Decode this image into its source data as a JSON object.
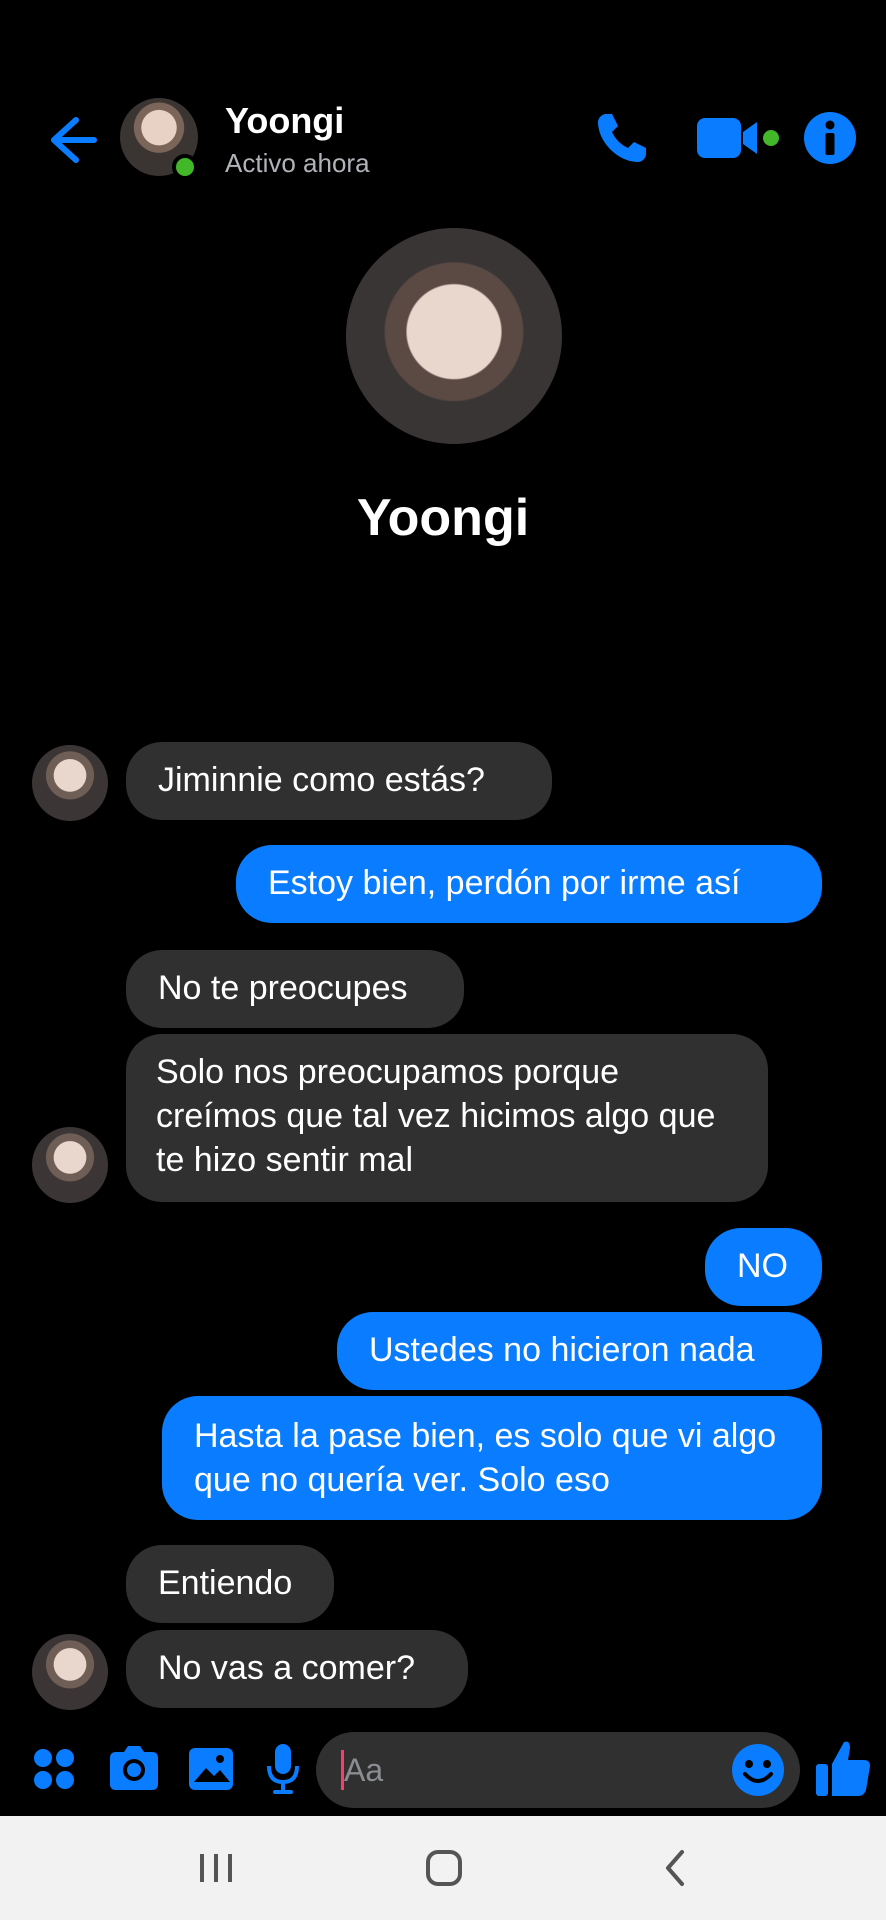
{
  "header": {
    "name": "Yoongi",
    "status": "Activo ahora"
  },
  "profile": {
    "name": "Yoongi"
  },
  "messages": [
    {
      "from": "them",
      "text": "Jiminnie como estás?"
    },
    {
      "from": "me",
      "text": "Estoy bien, perdón por irme así"
    },
    {
      "from": "them",
      "text": "No te preocupes"
    },
    {
      "from": "them",
      "text": "Solo nos preocupamos porque creímos que tal vez hicimos algo que te hizo sentir mal"
    },
    {
      "from": "me",
      "text": "NO"
    },
    {
      "from": "me",
      "text": "Ustedes no hicieron nada"
    },
    {
      "from": "me",
      "text": "Hasta la pase bien, es solo que vi algo que no quería ver. Solo eso"
    },
    {
      "from": "them",
      "text": "Entiendo"
    },
    {
      "from": "them",
      "text": "No vas a comer?"
    }
  ],
  "composer": {
    "placeholder": "Aa",
    "icons": [
      "menu-grid-icon",
      "camera-icon",
      "gallery-icon",
      "mic-icon",
      "emoji-icon",
      "thumbs-up-icon"
    ]
  },
  "colors": {
    "accent": "#0a7cff",
    "incoming_bubble": "#303030",
    "online": "#42b72a",
    "background": "#000000"
  }
}
